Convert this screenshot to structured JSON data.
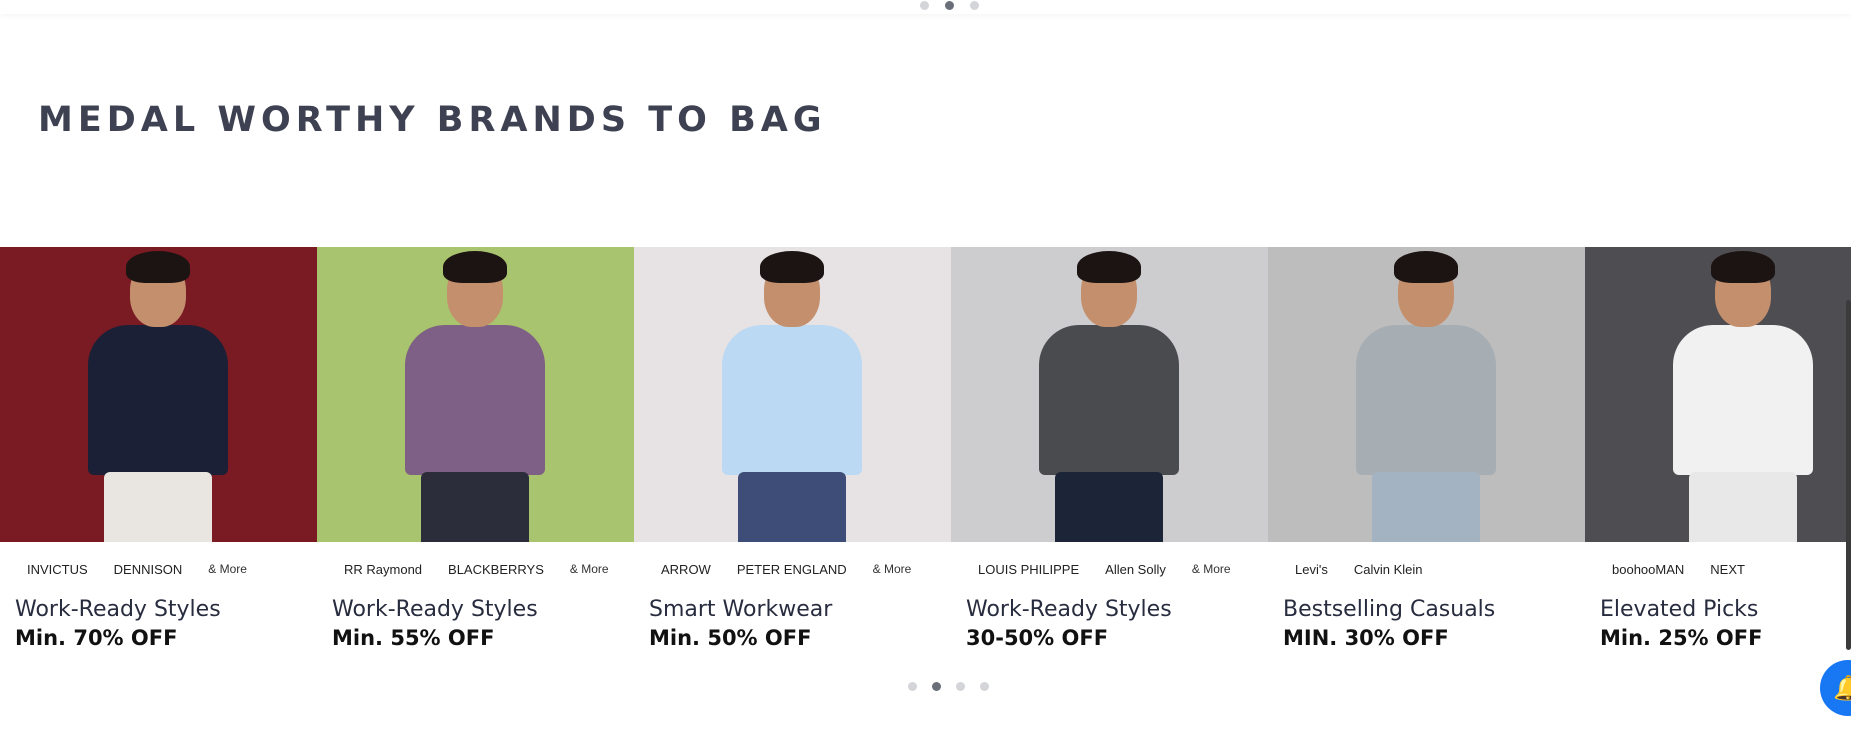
{
  "top_carousel": {
    "dot_count": 3,
    "active_index": 1
  },
  "section": {
    "title": "MEDAL WORTHY BRANDS TO BAG"
  },
  "cards": [
    {
      "logos": [
        "INVICTUS",
        "DENNISON",
        "& More"
      ],
      "caption": "Work-Ready Styles",
      "offer": "Min. 70% OFF",
      "bg": "#7a1a22",
      "shirt": "#1b2036",
      "pants": "#e9e6e2"
    },
    {
      "logos": [
        "RR Raymond",
        "BLACKBERRYS",
        "& More"
      ],
      "caption": "Work-Ready Styles",
      "offer": "Min. 55% OFF",
      "bg": "#a8c46e",
      "shirt": "#7e5f85",
      "pants": "#2b2d3a"
    },
    {
      "logos": [
        "ARROW",
        "PETER ENGLAND",
        "& More"
      ],
      "caption": "Smart Workwear",
      "offer": "Min. 50% OFF",
      "bg": "#e7e2e3",
      "shirt": "#bcd9f3",
      "pants": "#3d4d78"
    },
    {
      "logos": [
        "LOUIS PHILIPPE",
        "Allen Solly",
        "& More"
      ],
      "caption": "Work-Ready Styles",
      "offer": "30-50% OFF",
      "bg": "#cdcdcf",
      "shirt": "#4a4b4f",
      "pants": "#1c2437"
    },
    {
      "logos": [
        "Levi's",
        "Calvin Klein"
      ],
      "caption": "Bestselling Casuals",
      "offer": "MIN. 30% OFF",
      "bg": "#bdbdbd",
      "shirt": "#a7aeb3",
      "pants": "#a3b3c2"
    },
    {
      "logos": [
        "boohooMAN",
        "NEXT"
      ],
      "caption": "Elevated Picks",
      "offer": "Min. 25% OFF",
      "bg": "#4d4d52",
      "shirt": "#f1f1f1",
      "pants": "#e8e8e8"
    }
  ],
  "bottom_carousel": {
    "dot_count": 4,
    "active_index": 1
  },
  "colors": {
    "title": "#3e4152",
    "dot_inactive": "#d4d5d9",
    "dot_active": "#696e79",
    "notify_button": "#1877f2"
  },
  "icons": {
    "notify": "bell-icon"
  }
}
